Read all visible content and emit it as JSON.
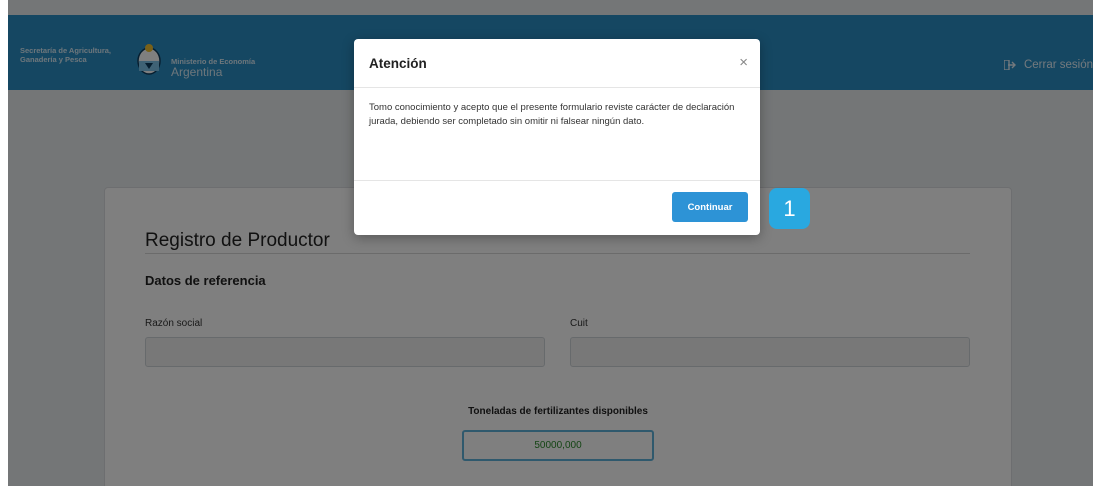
{
  "header": {
    "secretaria_line1": "Secretaría de Agricultura,",
    "secretaria_line2": "Ganadería y Pesca",
    "ministerio_small": "Ministerio de Economía",
    "ministerio_big": "Argentina",
    "logout_label": "Cerrar sesión",
    "background_color": "#2b8ec5"
  },
  "form": {
    "title": "Registro de Productor",
    "subtitle": "Datos de referencia",
    "fields": {
      "razon_social_label": "Razón social",
      "razon_social_value": "",
      "cuit_label": "Cuit",
      "cuit_value": ""
    },
    "toneladas_label": "Toneladas de fertilizantes disponibles",
    "toneladas_value": "50000,000"
  },
  "modal": {
    "title": "Atención",
    "close_symbol": "×",
    "body": "Tomo conocimiento y acepto que el presente formulario reviste carácter de declaración jurada, debiendo ser completado sin omitir ni falsear ningún dato.",
    "button_label": "Continuar",
    "button_color": "#2d93d6"
  },
  "step_badge": {
    "number": "1",
    "color": "#29a8e0"
  }
}
